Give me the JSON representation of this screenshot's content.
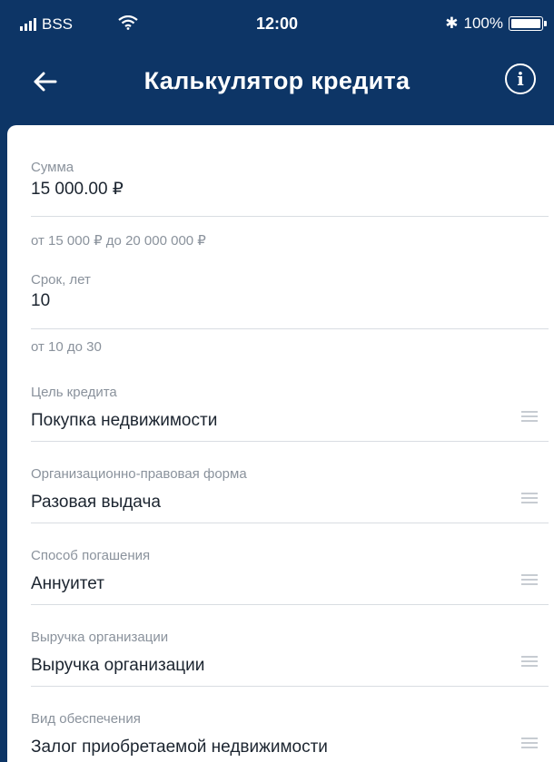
{
  "status_bar": {
    "carrier": "BSS",
    "time": "12:00",
    "bluetooth": "✱",
    "battery": "100%"
  },
  "nav": {
    "title": "Калькулятор кредита",
    "back_icon": "arrow-left-icon",
    "info_icon": "info-icon",
    "info_glyph": "i"
  },
  "form": {
    "amount": {
      "label": "Сумма",
      "value": "15 000.00 ₽",
      "hint": "от 15 000 ₽ до 20 000 000 ₽"
    },
    "term": {
      "label": "Срок, лет",
      "value": "10",
      "hint": "от 10 до 30"
    },
    "purpose": {
      "label": "Цель кредита",
      "value": "Покупка недвижимости"
    },
    "legal_form": {
      "label": "Организационно-правовая форма",
      "value": "Разовая выдача"
    },
    "repayment": {
      "label": "Способ погашения",
      "value": "Аннуитет"
    },
    "revenue": {
      "label": "Выручка организации",
      "value": "Выручка организации"
    },
    "collateral": {
      "label": "Вид обеспечения",
      "value": "Залог приобретаемой недвижимости"
    }
  },
  "colors": {
    "header_bg": "#0d3566",
    "text": "#1c2530",
    "muted": "#8a929c"
  }
}
